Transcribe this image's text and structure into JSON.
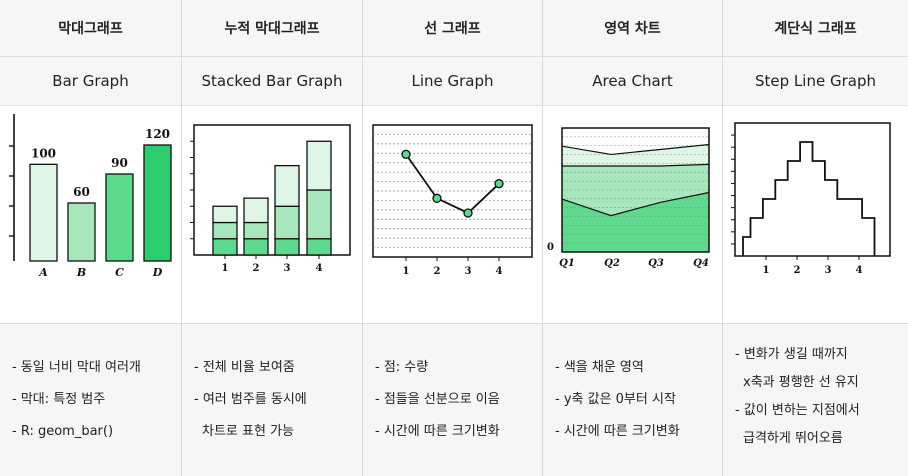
{
  "columns": [
    {
      "korean_title": "막대그래프",
      "english_title": "Bar Graph",
      "bullets": [
        "- 동일 너비 막대 여러개",
        "- 막대: 특정 범주",
        "- R: geom_bar()"
      ]
    },
    {
      "korean_title": "누적 막대그래프",
      "english_title": "Stacked Bar Graph",
      "bullets": [
        "- 전체 비율 보여줌",
        "- 여러 범주를 동시에",
        "차트로 표현 가능"
      ]
    },
    {
      "korean_title": "선 그래프",
      "english_title": "Line Graph",
      "bullets": [
        "- 점: 수량",
        "- 점들을 선분으로 이음",
        "- 시간에 따른 크기변화"
      ]
    },
    {
      "korean_title": "영역 차트",
      "english_title": "Area Chart",
      "bullets": [
        "- 색을 채운 영역",
        "- y축 값은 0부터 시작",
        "- 시간에 따른 크기변화"
      ]
    },
    {
      "korean_title": "계단식 그래프",
      "english_title": "Step Line Graph",
      "bullets": [
        "- 변화가 생길 때까지",
        "x축과 평행한 선 유지",
        "- 값이 변하는 지점에서",
        "급격하게 뛰어오름"
      ]
    }
  ],
  "colors": {
    "green_1": "#dff5e6",
    "green_2": "#a8e6bd",
    "green_3": "#5fd98d",
    "green_4": "#2ecc71",
    "header_bg": "#f6f6f6",
    "axis": "#111111"
  },
  "chart_data": [
    {
      "type": "bar",
      "categories": [
        "A",
        "B",
        "C",
        "D"
      ],
      "values": [
        100,
        60,
        90,
        120
      ],
      "ylim": [
        0,
        150
      ]
    },
    {
      "type": "bar",
      "stacked": true,
      "categories": [
        "1",
        "2",
        "3",
        "4"
      ],
      "series": [
        {
          "values": [
            1,
            1,
            1,
            1
          ]
        },
        {
          "values": [
            1,
            1,
            2,
            3
          ]
        },
        {
          "values": [
            1,
            1.5,
            2.5,
            3
          ]
        }
      ],
      "ylim": [
        0,
        8
      ]
    },
    {
      "type": "line",
      "x": [
        1,
        2,
        3,
        4
      ],
      "values": [
        7,
        4,
        3,
        5
      ],
      "ylim": [
        0,
        9
      ]
    },
    {
      "type": "area",
      "categories": [
        "Q1",
        "Q2",
        "Q3",
        "Q4"
      ],
      "ytick": "0",
      "series": [
        {
          "values": [
            3.2,
            2.2,
            3,
            3.6
          ]
        },
        {
          "values": [
            5.2,
            5.2,
            5.2,
            5.3
          ]
        },
        {
          "values": [
            6.4,
            5.9,
            6.2,
            6.5
          ]
        }
      ],
      "ylim": [
        0,
        7.5
      ]
    },
    {
      "type": "line",
      "step": true,
      "x": [
        0.1,
        0.5,
        0.9,
        1.3,
        1.7,
        2.1,
        2.5,
        2.9,
        3.3,
        4.1,
        4.5
      ],
      "values": [
        1,
        2,
        3,
        4,
        5,
        6,
        5,
        4,
        3,
        2,
        0
      ],
      "xticks": [
        "1",
        "2",
        "3",
        "4"
      ],
      "ylim": [
        0,
        7
      ]
    }
  ]
}
